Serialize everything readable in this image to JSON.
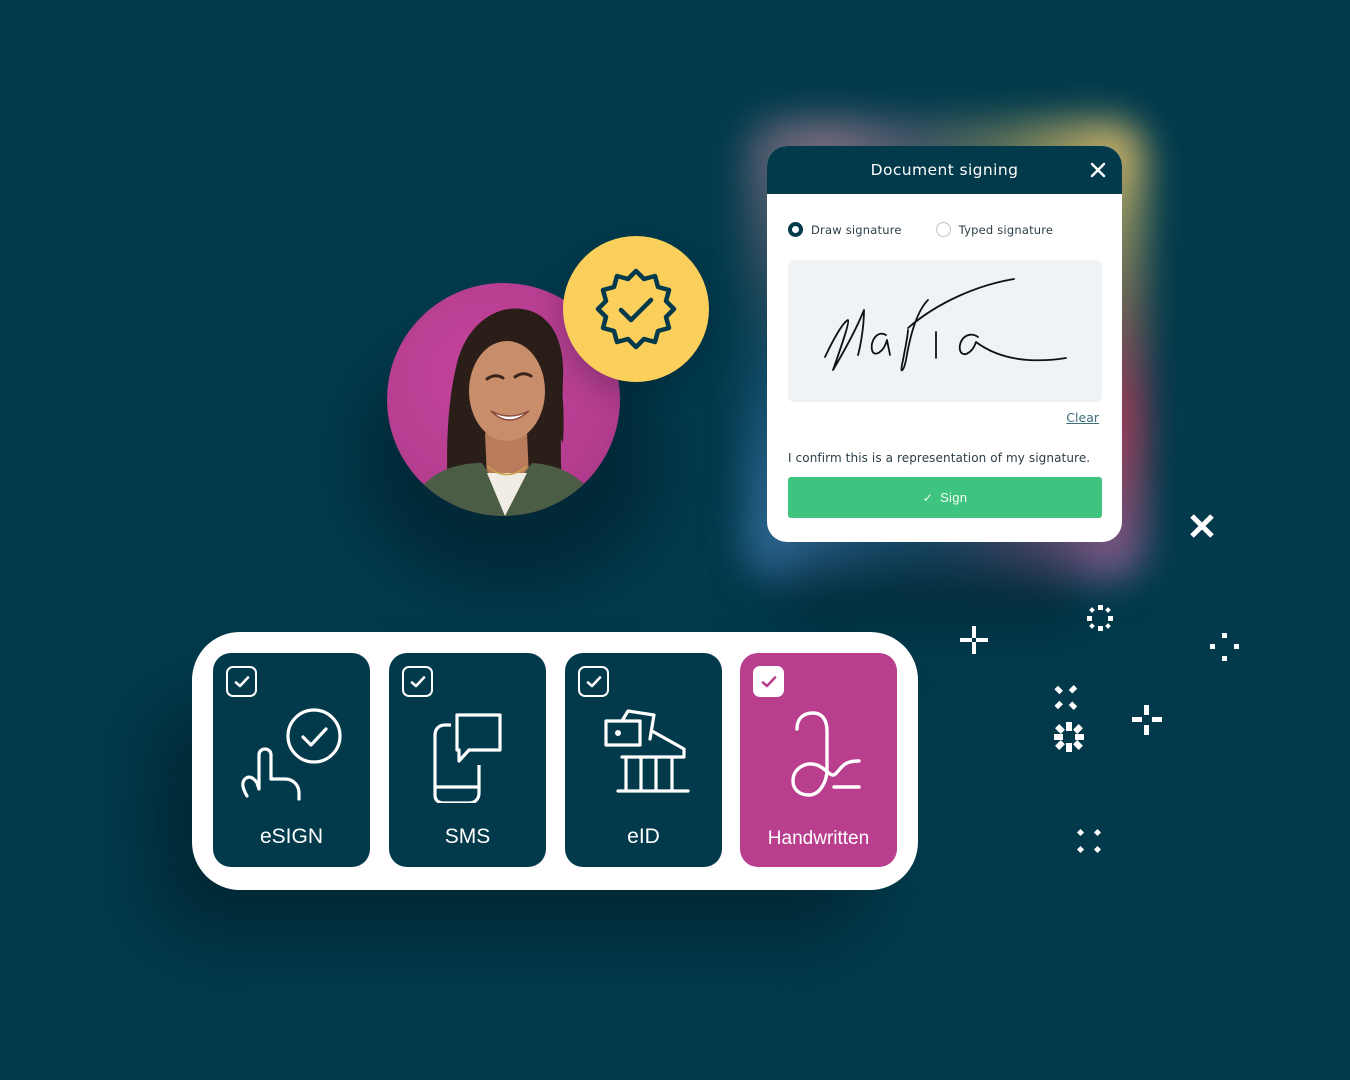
{
  "colors": {
    "background": "#023a4c",
    "dialog_header": "#033a4b",
    "sign_button": "#3ec47f",
    "avatar_bg": "#b93e8e",
    "badge_bg": "#fbcf5c",
    "card_default": "#033a4b",
    "card_selected": "#b93e8e"
  },
  "profile": {
    "avatar_alt": "Smiling woman",
    "badge_icon": "verified-badge-icon"
  },
  "dialog": {
    "title": "Document signing",
    "close_icon": "close-icon",
    "signature_modes": [
      {
        "label": "Draw signature",
        "checked": true
      },
      {
        "label": "Typed signature",
        "checked": false
      }
    ],
    "signature_name": "Maria",
    "clear_label": "Clear",
    "confirmation_text": "I confirm this is a representation of my signature.",
    "sign_button": {
      "icon": "✓",
      "label": "Sign"
    }
  },
  "methods": [
    {
      "label": "eSIGN",
      "icon": "touch-check-icon",
      "checked": true,
      "selected": false
    },
    {
      "label": "SMS",
      "icon": "phone-message-icon",
      "checked": true,
      "selected": false
    },
    {
      "label": "eID",
      "icon": "id-bank-icon",
      "checked": true,
      "selected": false
    },
    {
      "label": "Handwritten",
      "icon": "handwritten-signature-icon",
      "checked": true,
      "selected": true
    }
  ],
  "decorations": [
    "sparkle-x-icon",
    "sparkle-plus-icon",
    "sparkle-ring-icon",
    "sparkle-dots-icon",
    "sparkle-x-dots-icon",
    "sparkle-burst-icon",
    "sparkle-cross-dots-icon",
    "sparkle-four-dots-icon"
  ]
}
